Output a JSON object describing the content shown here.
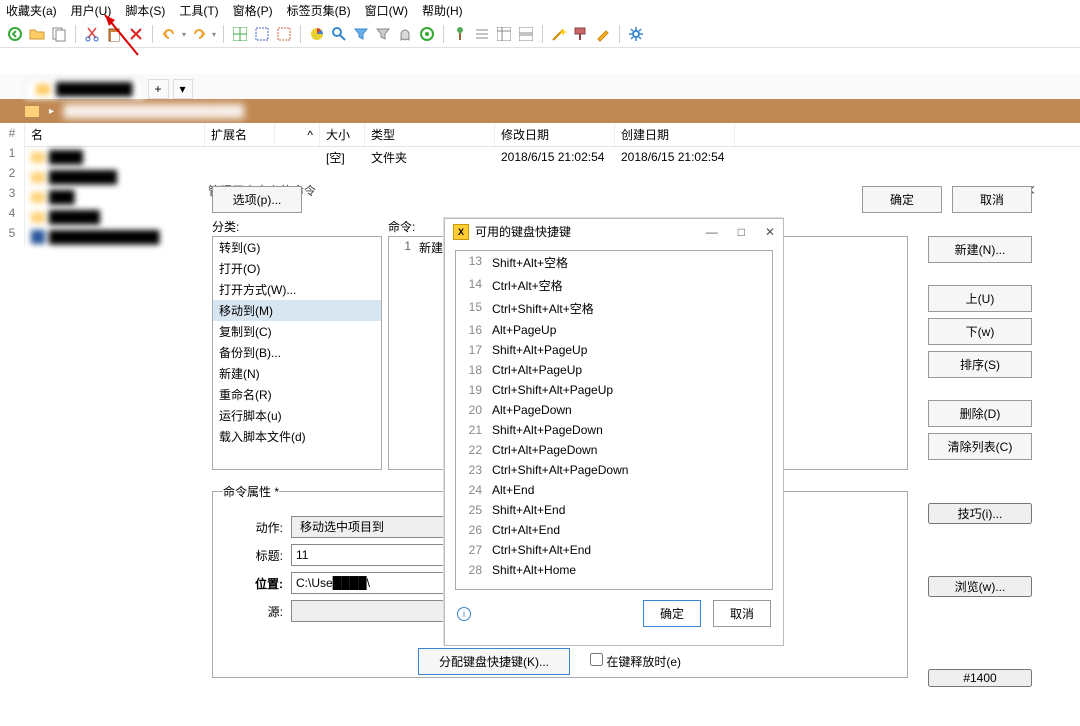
{
  "menu": [
    "收藏夹(a)",
    "用户(U)",
    "脚本(S)",
    "工具(T)",
    "窗格(P)",
    "标签页集(B)",
    "窗口(W)",
    "帮助(H)"
  ],
  "tabs": {
    "tab1": "█████████",
    "plus": "+",
    "dd": "▾"
  },
  "breadcrumb": {
    "path": "███████████████████"
  },
  "columns": {
    "name": "#  名",
    "ext": "扩展名",
    "size": "大小",
    "type": "类型",
    "modified": "修改日期",
    "created": "创建日期",
    "sort": "^"
  },
  "rows": [
    {
      "type": "folder",
      "name": "████",
      "size": "[空]",
      "ftype": "文件夹",
      "mod": "2018/6/15 21:02:54",
      "cre": "2018/6/15 21:02:54"
    },
    {
      "type": "folder",
      "name": "████████"
    },
    {
      "type": "folder",
      "name": "███"
    },
    {
      "type": "folder",
      "name": "██████"
    },
    {
      "type": "word",
      "name": "█████████████"
    }
  ],
  "dlg1": {
    "title": "管理用户定义的命令",
    "cat_label": "分类:",
    "cmd_label": "命令:",
    "categories": [
      "转到(G)",
      "打开(O)",
      "打开方式(W)...",
      "移动到(M)",
      "复制到(C)",
      "备份到(B)...",
      "新建(N)",
      "重命名(R)",
      "运行脚本(u)",
      "载入脚本文件(d)"
    ],
    "cat_selected": 3,
    "cmd_row_num": "1",
    "cmd_row_text": "新建",
    "group": "命令属性 *",
    "f_action": "动作:",
    "f_action_val": "移动选中项目到",
    "f_title": "标题:",
    "f_title_val": "11",
    "f_loc": "位置:",
    "f_loc_val": "C:\\Use████\\",
    "f_src": "源:",
    "assign_btn": "分配键盘快捷键(K)...",
    "assign_chk": "在键释放时(e)",
    "btns_right": [
      "新建(N)...",
      "上(U)",
      "下(w)",
      "排序(S)",
      "删除(D)",
      "清除列表(C)"
    ],
    "btns_right2": [
      "技巧(i)...",
      "浏览(w)..."
    ],
    "num_btn": "#1400",
    "options": "选项(p)...",
    "ok": "确定",
    "cancel": "取消"
  },
  "dlg2": {
    "title": "可用的键盘快捷键",
    "items": [
      {
        "n": 13,
        "k": "Shift+Alt+空格"
      },
      {
        "n": 14,
        "k": "Ctrl+Alt+空格"
      },
      {
        "n": 15,
        "k": "Ctrl+Shift+Alt+空格"
      },
      {
        "n": 16,
        "k": "Alt+PageUp"
      },
      {
        "n": 17,
        "k": "Shift+Alt+PageUp"
      },
      {
        "n": 18,
        "k": "Ctrl+Alt+PageUp"
      },
      {
        "n": 19,
        "k": "Ctrl+Shift+Alt+PageUp"
      },
      {
        "n": 20,
        "k": "Alt+PageDown"
      },
      {
        "n": 21,
        "k": "Shift+Alt+PageDown"
      },
      {
        "n": 22,
        "k": "Ctrl+Alt+PageDown"
      },
      {
        "n": 23,
        "k": "Ctrl+Shift+Alt+PageDown"
      },
      {
        "n": 24,
        "k": "Alt+End"
      },
      {
        "n": 25,
        "k": "Shift+Alt+End"
      },
      {
        "n": 26,
        "k": "Ctrl+Alt+End"
      },
      {
        "n": 27,
        "k": "Ctrl+Shift+Alt+End"
      },
      {
        "n": 28,
        "k": "Shift+Alt+Home"
      }
    ],
    "ok": "确定",
    "cancel": "取消"
  }
}
